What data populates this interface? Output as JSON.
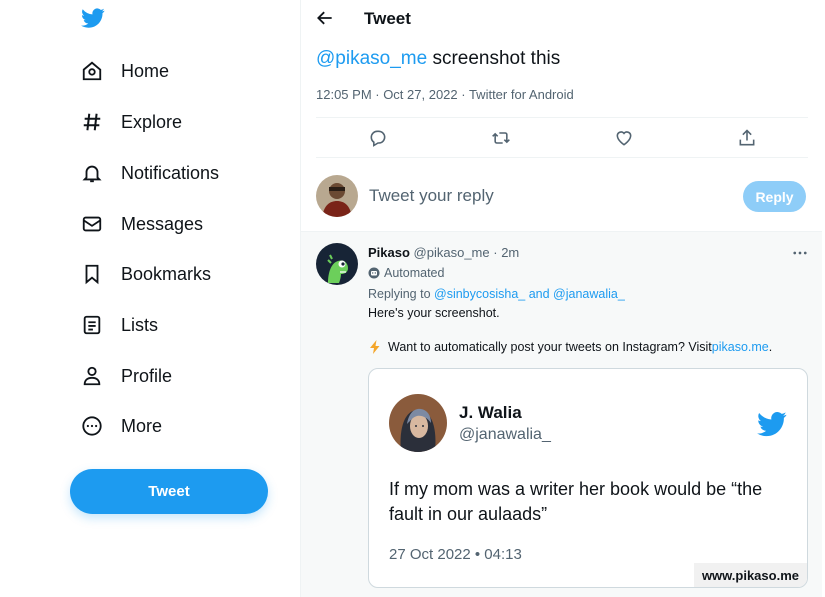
{
  "brand": {
    "accent": "#1d9bf0",
    "icon": "twitter-bird-icon"
  },
  "sidebar": {
    "items": [
      {
        "label": "Home",
        "icon": "home-icon"
      },
      {
        "label": "Explore",
        "icon": "hashtag-icon"
      },
      {
        "label": "Notifications",
        "icon": "bell-icon"
      },
      {
        "label": "Messages",
        "icon": "envelope-icon"
      },
      {
        "label": "Bookmarks",
        "icon": "bookmark-icon"
      },
      {
        "label": "Lists",
        "icon": "list-icon"
      },
      {
        "label": "Profile",
        "icon": "person-icon"
      },
      {
        "label": "More",
        "icon": "more-circle-icon"
      }
    ],
    "tweet_button": "Tweet"
  },
  "header": {
    "title": "Tweet",
    "back_icon": "arrow-left-icon"
  },
  "tweet": {
    "mention": "@pikaso_me",
    "text": " screenshot this",
    "meta": "12:05 PM · Oct 27, 2022 · Twitter for Android",
    "actions": [
      "reply-icon",
      "retweet-icon",
      "like-icon",
      "share-icon"
    ]
  },
  "reply_box": {
    "placeholder": "Tweet your reply",
    "button": "Reply"
  },
  "reply": {
    "name": "Pikaso",
    "handle": "@pikaso_me",
    "time": "· 2m",
    "automated": "Automated",
    "replying_prefix": "Replying to ",
    "replying_user1": "@sinbycosisha_",
    "replying_and": " and ",
    "replying_user2": "@janawalia_",
    "body": "Here's your screenshot.",
    "promo_text": "Want to automatically post your tweets on Instagram? Visit ",
    "promo_link": "pikaso.me",
    "promo_end": "."
  },
  "card": {
    "name": "J. Walia",
    "handle": "@janawalia_",
    "text": "If my mom was a writer her book would be “the fault in our aulaads”",
    "date": "27 Oct 2022 • 04:13",
    "watermark": "www.pikaso.me"
  }
}
